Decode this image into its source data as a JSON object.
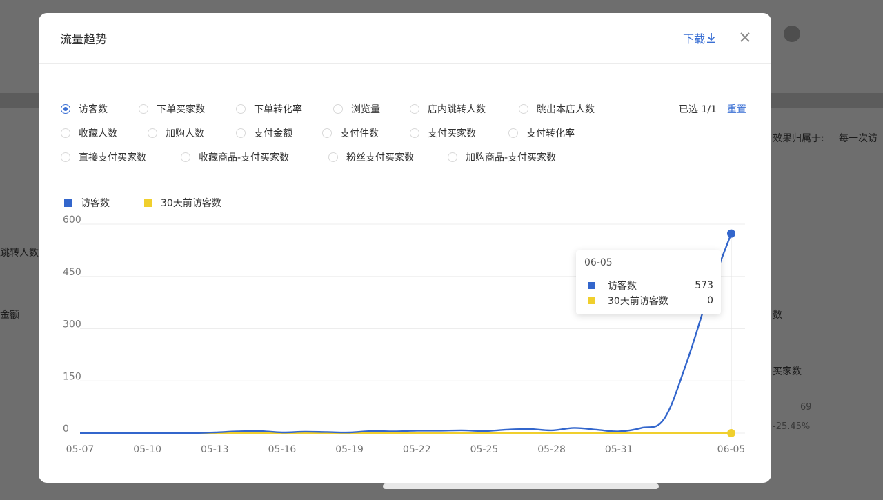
{
  "background": {
    "label_jump": "跳转人数",
    "label_amount": "金额",
    "attribution_label": "效果归属于:",
    "attribution_value": "每一次访",
    "count_suffix": "数",
    "buyers_label": "买家数",
    "buyers_value": "69",
    "buyers_change": "-25.45%"
  },
  "modal": {
    "title": "流量趋势",
    "download_label": "下载",
    "close_label": "×",
    "selected_count": "已选 1/1",
    "reset_label": "重置",
    "metrics": [
      {
        "label": "访客数",
        "checked": true
      },
      {
        "label": "下单买家数",
        "checked": false
      },
      {
        "label": "下单转化率",
        "checked": false
      },
      {
        "label": "浏览量",
        "checked": false
      },
      {
        "label": "店内跳转人数",
        "checked": false
      },
      {
        "label": "跳出本店人数",
        "checked": false
      },
      {
        "label": "收藏人数",
        "checked": false
      },
      {
        "label": "加购人数",
        "checked": false
      },
      {
        "label": "支付金额",
        "checked": false
      },
      {
        "label": "支付件数",
        "checked": false
      },
      {
        "label": "支付买家数",
        "checked": false
      },
      {
        "label": "支付转化率",
        "checked": false
      },
      {
        "label": "直接支付买家数",
        "checked": false
      },
      {
        "label": "收藏商品-支付买家数",
        "checked": false
      },
      {
        "label": "粉丝支付买家数",
        "checked": false
      },
      {
        "label": "加购商品-支付买家数",
        "checked": false
      }
    ],
    "legend": [
      {
        "label": "访客数",
        "color": "#3366cc"
      },
      {
        "label": "30天前访客数",
        "color": "#f0cf2d"
      }
    ],
    "tooltip": {
      "date": "06-05",
      "rows": [
        {
          "name": "访客数",
          "value": "573",
          "color": "#3366cc"
        },
        {
          "name": "30天前访客数",
          "value": "0",
          "color": "#f0cf2d"
        }
      ]
    }
  },
  "chart_data": {
    "type": "line",
    "title": "",
    "xlabel": "",
    "ylabel": "",
    "ylim": [
      0,
      600
    ],
    "y_ticks": [
      "0",
      "150",
      "300",
      "450",
      "600"
    ],
    "x_tick_labels": [
      "05-07",
      "05-10",
      "05-13",
      "05-16",
      "05-19",
      "05-22",
      "05-25",
      "05-28",
      "05-31",
      "06-05"
    ],
    "x": [
      "05-07",
      "05-08",
      "05-09",
      "05-10",
      "05-11",
      "05-12",
      "05-13",
      "05-14",
      "05-15",
      "05-16",
      "05-17",
      "05-18",
      "05-19",
      "05-20",
      "05-21",
      "05-22",
      "05-23",
      "05-24",
      "05-25",
      "05-26",
      "05-27",
      "05-28",
      "05-29",
      "05-30",
      "05-31",
      "06-01",
      "06-02",
      "06-03",
      "06-04",
      "06-05"
    ],
    "grid": true,
    "legend_position": "top-left",
    "series": [
      {
        "name": "访客数",
        "color": "#3366cc",
        "values": [
          0,
          0,
          0,
          0,
          0,
          0,
          2,
          5,
          6,
          2,
          4,
          3,
          2,
          6,
          5,
          7,
          7,
          8,
          6,
          10,
          12,
          8,
          15,
          10,
          5,
          15,
          40,
          200,
          400,
          573
        ]
      },
      {
        "name": "30天前访客数",
        "color": "#f0cf2d",
        "values": [
          0,
          0,
          0,
          0,
          0,
          0,
          0,
          0,
          0,
          0,
          0,
          0,
          0,
          0,
          0,
          0,
          0,
          0,
          0,
          0,
          0,
          0,
          0,
          0,
          0,
          0,
          0,
          0,
          0,
          0
        ]
      }
    ]
  }
}
